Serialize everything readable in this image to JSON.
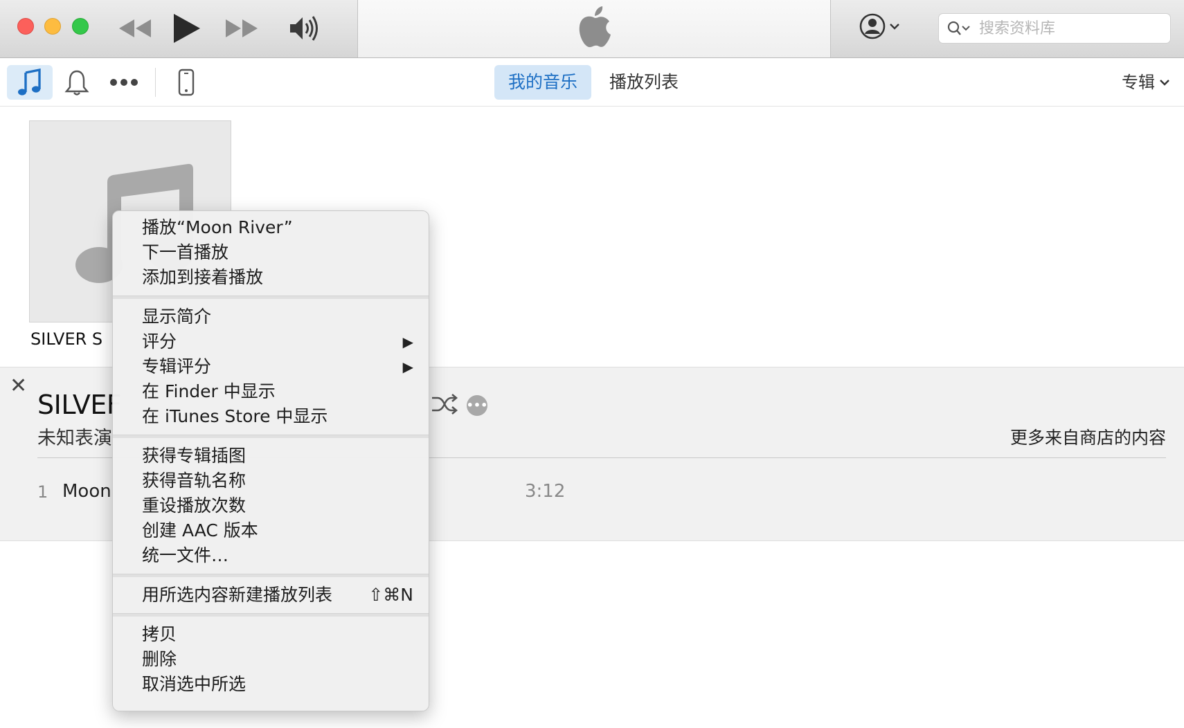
{
  "search": {
    "placeholder": "搜索资料库"
  },
  "toolbar": {
    "tabs": [
      {
        "label": "我的音乐",
        "selected": true
      },
      {
        "label": "播放列表",
        "selected": false
      }
    ],
    "view_selector": "专辑"
  },
  "album": {
    "title_truncated": "SILVER S"
  },
  "detail": {
    "title": "SILVEF",
    "artist": "未知表演",
    "store_link": "更多来自商店的内容",
    "track": {
      "number": "1",
      "name": "Moon",
      "duration": "3:12"
    }
  },
  "menu": {
    "groups": [
      [
        {
          "label": "播放“Moon River”"
        },
        {
          "label": "下一首播放"
        },
        {
          "label": "添加到接着播放"
        }
      ],
      [
        {
          "label": "显示简介"
        },
        {
          "label": "评分",
          "submenu": true
        },
        {
          "label": "专辑评分",
          "submenu": true
        },
        {
          "label": "在 Finder 中显示"
        },
        {
          "label": "在 iTunes Store 中显示"
        }
      ],
      [
        {
          "label": "获得专辑插图"
        },
        {
          "label": "获得音轨名称"
        },
        {
          "label": "重设播放次数"
        },
        {
          "label": "创建 AAC 版本"
        },
        {
          "label": "统一文件…"
        }
      ],
      [
        {
          "label": "用所选内容新建播放列表",
          "shortcut": "⇧⌘N"
        }
      ],
      [
        {
          "label": "拷贝"
        },
        {
          "label": "删除"
        },
        {
          "label": "取消选中所选"
        }
      ]
    ]
  },
  "colors": {
    "accent": "#1d6fc4",
    "selected_tab_bg": "#d4e6f7",
    "close": "#fc605b",
    "minimize": "#fdbc40",
    "maximize": "#34c84a"
  },
  "icons": [
    "rewind-icon",
    "play-icon",
    "fast-forward-icon",
    "volume-icon",
    "apple-logo-icon",
    "account-icon",
    "search-icon",
    "music-note-icon",
    "bell-icon",
    "more-icon",
    "iphone-icon",
    "shuffle-icon"
  ]
}
